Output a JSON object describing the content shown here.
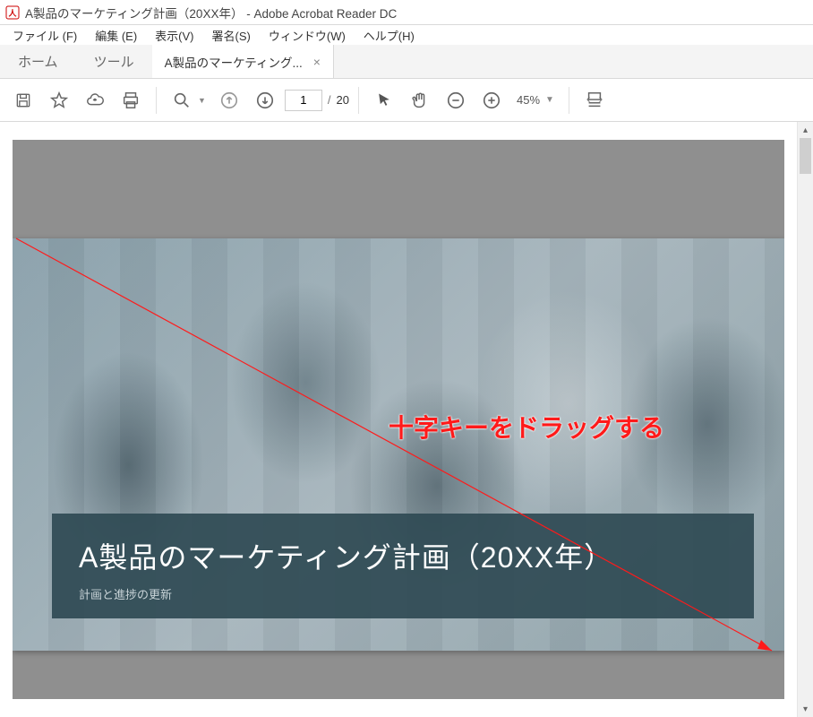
{
  "window": {
    "title": "A製品のマーケティング計画（20XX年） - Adobe Acrobat Reader DC"
  },
  "menubar": {
    "file": "ファイル (F)",
    "edit": "編集 (E)",
    "view": "表示(V)",
    "sign": "署名(S)",
    "window": "ウィンドウ(W)",
    "help": "ヘルプ(H)"
  },
  "tabs": {
    "home": "ホーム",
    "tools": "ツール",
    "doc": "A製品のマーケティング..."
  },
  "toolbar": {
    "page_current": "1",
    "page_sep": "/",
    "page_total": "20",
    "zoom_value": "45%"
  },
  "document": {
    "slide_title": "A製品のマーケティング計画（20XX年）",
    "slide_subtitle": "計画と進捗の更新"
  },
  "annotation": {
    "text": "十字キーをドラッグする"
  }
}
